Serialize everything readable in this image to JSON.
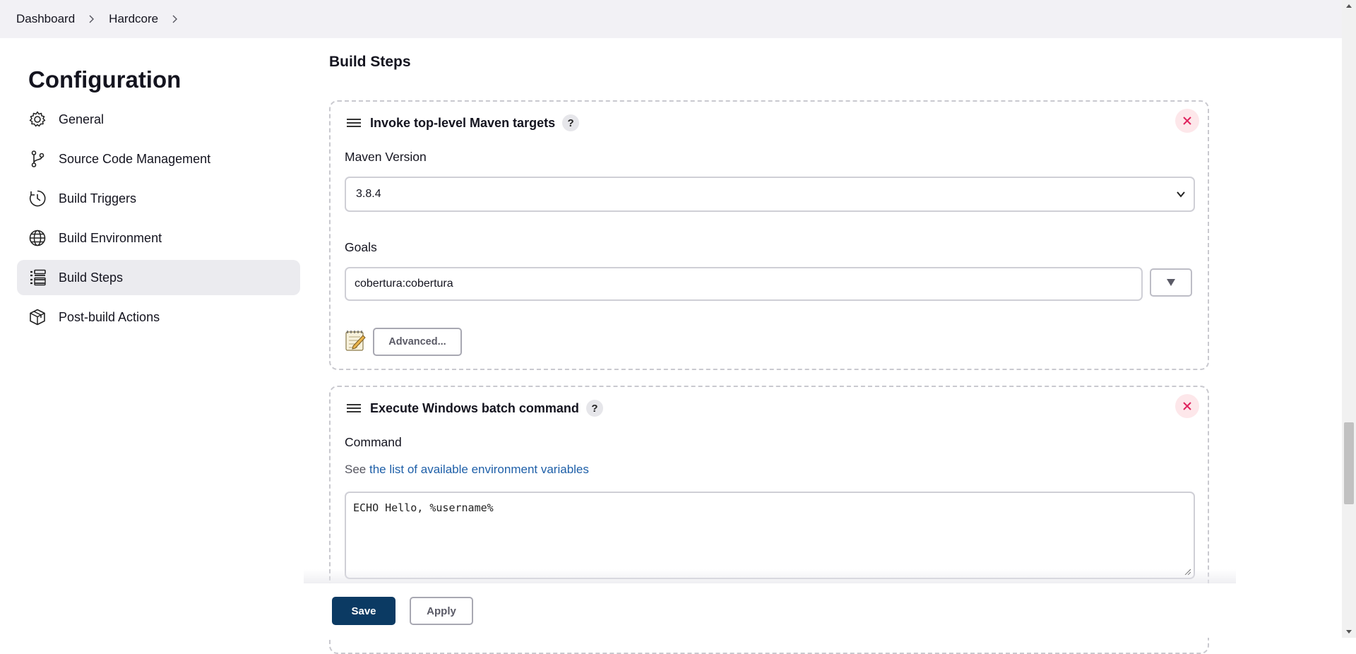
{
  "breadcrumb": {
    "items": [
      "Dashboard",
      "Hardcore"
    ]
  },
  "sidebar": {
    "title": "Configuration",
    "items": [
      {
        "label": "General",
        "icon": "gear-icon"
      },
      {
        "label": "Source Code Management",
        "icon": "branch-icon"
      },
      {
        "label": "Build Triggers",
        "icon": "clock-icon"
      },
      {
        "label": "Build Environment",
        "icon": "globe-icon"
      },
      {
        "label": "Build Steps",
        "icon": "list-icon",
        "active": true
      },
      {
        "label": "Post-build Actions",
        "icon": "package-icon"
      }
    ]
  },
  "main": {
    "section_title": "Build Steps",
    "steps": [
      {
        "title": "Invoke top-level Maven targets",
        "help": "?",
        "maven_version_label": "Maven Version",
        "maven_version_value": "3.8.4",
        "goals_label": "Goals",
        "goals_value": "cobertura:cobertura",
        "advanced_label": "Advanced..."
      },
      {
        "title": "Execute Windows batch command",
        "help": "?",
        "command_label": "Command",
        "hint_prefix": "See",
        "hint_link": "the list of available environment variables",
        "command_value": "ECHO Hello, %username%"
      }
    ]
  },
  "actions": {
    "save_label": "Save",
    "apply_label": "Apply"
  },
  "colors": {
    "primary": "#0b3a63",
    "link": "#1e5fa8",
    "close_bg": "#fde7ea",
    "close_fg": "#e0245e"
  }
}
